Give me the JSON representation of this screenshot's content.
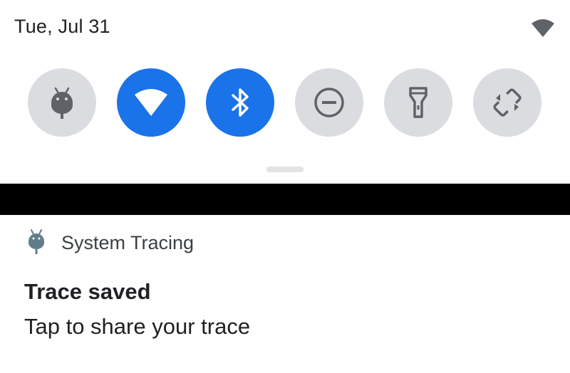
{
  "status_bar": {
    "date": "Tue, Jul 31",
    "signal_icon": "wifi-icon"
  },
  "quick_settings": {
    "tiles": [
      {
        "icon": "android-bug-icon",
        "state": "off"
      },
      {
        "icon": "wifi-icon",
        "state": "on"
      },
      {
        "icon": "bluetooth-icon",
        "state": "on"
      },
      {
        "icon": "do-not-disturb-icon",
        "state": "off"
      },
      {
        "icon": "flashlight-icon",
        "state": "off"
      },
      {
        "icon": "auto-rotate-icon",
        "state": "off"
      }
    ],
    "colors": {
      "active": "#1a73e8",
      "inactive": "#dadce0",
      "inactive_icon": "#5f6368"
    }
  },
  "notification": {
    "app_icon": "android-bug-icon",
    "app_name": "System Tracing",
    "title": "Trace saved",
    "text": "Tap to share your trace"
  }
}
